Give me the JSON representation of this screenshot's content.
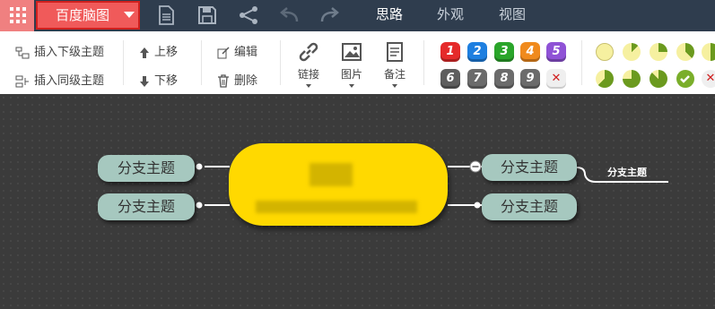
{
  "app": {
    "menu_label": "百度脑图"
  },
  "tabs": [
    {
      "label": "思路",
      "active": true
    },
    {
      "label": "外观",
      "active": false
    },
    {
      "label": "视图",
      "active": false
    }
  ],
  "toolbar": {
    "insert_child": "插入下级主题",
    "insert_sibling": "插入同级主题",
    "move_up": "上移",
    "move_down": "下移",
    "edit": "编辑",
    "delete": "删除",
    "link": "链接",
    "image": "图片",
    "note": "备注"
  },
  "priority": {
    "items": [
      {
        "label": "1",
        "color": "#e52a2a"
      },
      {
        "label": "2",
        "color": "#1e7fe0"
      },
      {
        "label": "3",
        "color": "#2aa52a"
      },
      {
        "label": "4",
        "color": "#f08a1c"
      },
      {
        "label": "5",
        "color": "#8f52d6"
      },
      {
        "label": "6",
        "color": "#5e5e5e"
      },
      {
        "label": "7",
        "color": "#6b6b6b"
      },
      {
        "label": "8",
        "color": "#6b6b6b"
      },
      {
        "label": "9",
        "color": "#6b6b6b"
      }
    ],
    "remove_icon": "close-icon"
  },
  "progress": {
    "levels": [
      0,
      0.125,
      0.25,
      0.375,
      0.5,
      0.625,
      0.75,
      0.875,
      1
    ],
    "remove_icon": "close-icon"
  },
  "colors": {
    "center": "#ffd900",
    "branch": "#a6c8bf",
    "topbar": "#2f3d4e",
    "menu": "#f05a5a"
  },
  "mindmap": {
    "branches": [
      "分支主题",
      "分支主题",
      "分支主题",
      "分支主题"
    ],
    "sub_topic": "分支主题"
  }
}
